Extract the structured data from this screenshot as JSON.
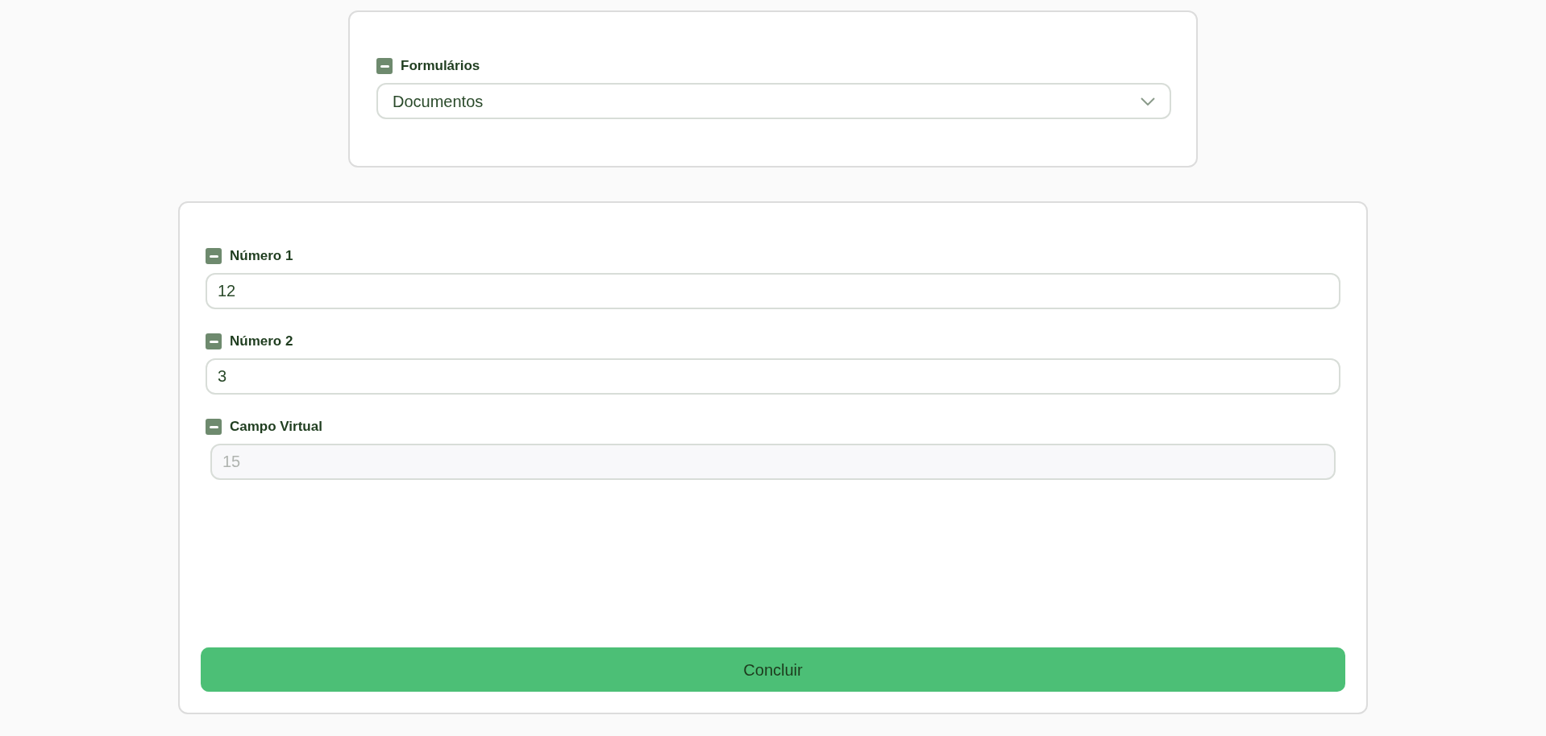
{
  "form_selector": {
    "label": "Formulários",
    "value": "Documentos"
  },
  "fields": [
    {
      "label": "Número 1",
      "value": "12",
      "disabled": false
    },
    {
      "label": "Número 2",
      "value": "3",
      "disabled": false
    },
    {
      "label": "Campo Virtual",
      "value": "15",
      "disabled": true
    }
  ],
  "submit_button": {
    "label": "Concluir"
  }
}
